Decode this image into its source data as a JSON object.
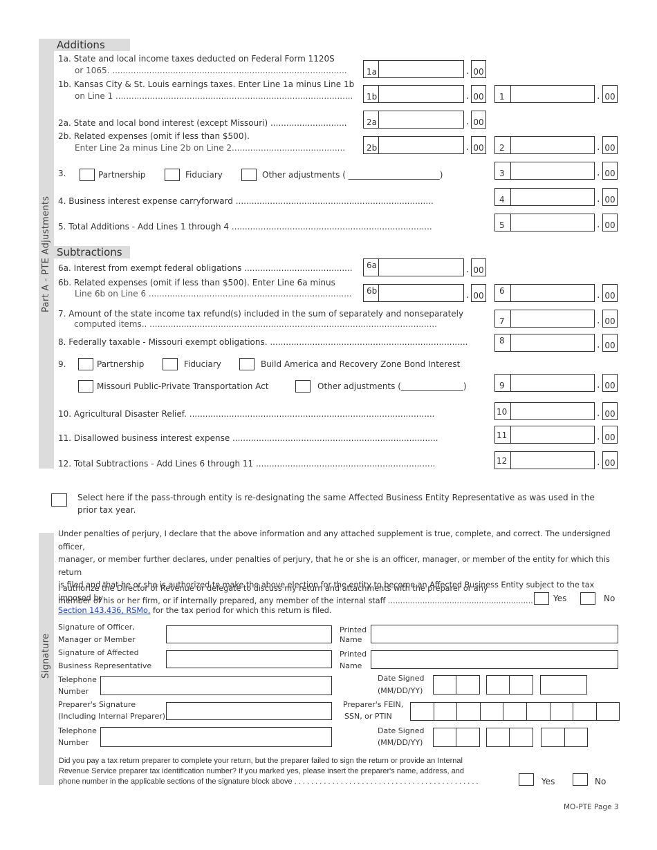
{
  "part_a": {
    "sidebar_label": "Part A - PTE Adjustments",
    "additions": {
      "heading": "Additions",
      "line_1a": {
        "text_1": "1a. State and local income taxes deducted on Federal Form 1120S",
        "text_2": "or 1065. .........................................................................................",
        "box_label": "1a",
        "cents": "00"
      },
      "line_1b": {
        "text_1": "1b. Kansas City & St. Louis earnings taxes. Enter Line 1a minus Line 1b",
        "text_2": "on Line 1 ..........................................................................................",
        "box_label": "1b",
        "cents": "00"
      },
      "line_1": {
        "box_label": "1",
        "cents": "00"
      },
      "line_2a": {
        "text_1": "2a. State and local bond interest (except Missouri) .............................",
        "box_label": "2a",
        "cents": "00"
      },
      "line_2b": {
        "text_1": "2b. Related expenses (omit if less than $500).",
        "text_2": "Enter Line 2a minus Line 2b on Line 2...........................................",
        "box_label": "2b",
        "cents": "00"
      },
      "line_2": {
        "box_label": "2",
        "cents": "00"
      },
      "line_3": {
        "number": "3.",
        "options": [
          "Partnership",
          "Fiduciary",
          "Other adjustments ( ______________________)"
        ],
        "box_label": "3",
        "cents": "00"
      },
      "line_4": {
        "text": "4.   Business interest expense carryforward ...........................................................................",
        "box_label": "4",
        "cents": "00"
      },
      "line_5": {
        "text": "5.   Total Additions - Add Lines 1 through 4 ............................................................................",
        "box_label": "5",
        "cents": "00"
      }
    },
    "subtractions": {
      "heading": "Subtractions",
      "line_6a": {
        "text_1": "6a. Interest from exempt federal obligations .........................................",
        "box_label": "6a",
        "cents": "00"
      },
      "line_6b": {
        "text_1": "6b. Related expenses (omit if less than  $500). Enter Line 6a minus",
        "text_2": "Line 6b on Line 6 .............................................................................",
        "box_label": "6b",
        "cents": "00"
      },
      "line_6": {
        "box_label": "6",
        "cents": "00"
      },
      "line_7": {
        "text_1": "7.   Amount of the state income tax refund(s) included in the sum of separately and nonseparately",
        "text_2": "computed items..  .............................................................................................................",
        "box_label": "7",
        "cents": "00"
      },
      "line_8": {
        "text": "8.   Federally taxable - Missouri exempt obligations. ...........................................................................",
        "box_label": "8",
        "cents": "00"
      },
      "line_9": {
        "number": "9.",
        "options_row1": [
          "Partnership",
          "Fiduciary",
          "Build America and Recovery Zone Bond Interest"
        ],
        "options_row2": [
          "Missouri Public-Private Transportation Act",
          "Other adjustments (_______________)"
        ],
        "box_label": "9",
        "cents": "00"
      },
      "line_10": {
        "text": "10. Agricultural Disaster Relief. .............................................................................................",
        "box_label": "10",
        "cents": "00"
      },
      "line_11": {
        "text": "11. Disallowed business interest expense ..............................................................................",
        "box_label": "11",
        "cents": "00"
      },
      "line_12": {
        "text": "12. Total Subtractions - Add Lines 6 through 11 ....................................................................",
        "box_label": "12",
        "cents": "00"
      }
    }
  },
  "redesignate": {
    "text_1": "Select here if the pass-through entity is re-designating the same Affected Business Entity Representative as was used in the",
    "text_2": "prior tax year."
  },
  "signature": {
    "sidebar_label": "Signature",
    "perjury_1": "Under penalties of perjury, I declare that the above information and any attached supplement is true, complete, and correct. The undersigned officer,",
    "perjury_2": "manager, or member further declares, under penalties of perjury, that he or she is an officer, manager, or member of the entity for which this return",
    "perjury_3": "is filed and that he or she is authorized to make the above election for the entity to become an Affected Business Entity subject to the tax imposed by",
    "perjury_link": "Section 143.436, RSMo,",
    "perjury_4": " for the tax period for which this return is filed.",
    "authorize_1": "I authorize the Director of Revenue or delegate to discuss my return and attachments with the preparer or any",
    "authorize_2": "member of his or her firm, or if internally prepared, any member of the internal staff .............................................................",
    "yes_label": "Yes",
    "no_label": "No",
    "officer_sig_1": "Signature of Officer,",
    "officer_sig_2": "Manager or Member",
    "affected_sig_1": "Signature of Affected",
    "affected_sig_2": "Business Representative",
    "printed_1": "Printed",
    "printed_2": "Name",
    "telephone_1": "Telephone",
    "telephone_2": "Number",
    "date_signed_1": "Date Signed",
    "date_signed_2": "(MM/DD/YY)",
    "preparer_sig_1": "Preparer's Signature",
    "preparer_sig_2": "(Including Internal Preparer)",
    "preparer_id_1": "Preparer's FEIN,",
    "preparer_id_2": "SSN, or PTIN",
    "paid_preparer_1": "Did you pay a tax return preparer to complete your return, but the preparer failed to sign the return or provide an Internal",
    "paid_preparer_2": "Revenue Service preparer tax identification number?  If you marked yes, please insert the preparer's name, address, and",
    "paid_preparer_3": "phone number in the applicable sections of the signature block above . . . . . . . . . . . . . . . . . . . . . . . . . . . . . . . . . . . . . . . . . . . ."
  },
  "footer": {
    "page_label": "MO-PTE Page 3"
  }
}
